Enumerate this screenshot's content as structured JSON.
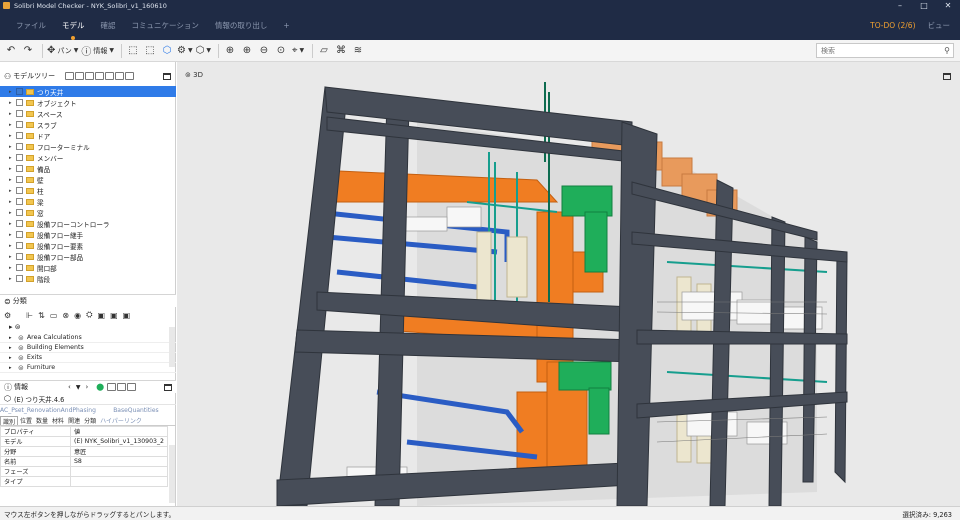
{
  "window": {
    "title": "Solibri Model Checker - NYK_Solibri_v1_160610"
  },
  "menu": {
    "items": [
      "ファイル",
      "モデル",
      "確認",
      "コミュニケーション",
      "情報の取り出し",
      "+"
    ],
    "active_index": 1,
    "todo": "TO-DO  (2/6)",
    "view": "ビュー"
  },
  "toolbar": {
    "pan_label": "パン",
    "info_label": "情報",
    "search_placeholder": "検索"
  },
  "model_tree": {
    "title": "モデルツリー",
    "items": [
      "つり天井",
      "オブジェクト",
      "スペース",
      "スラブ",
      "ドア",
      "フローターミナル",
      "メンバー",
      "備品",
      "壁",
      "柱",
      "梁",
      "窓",
      "設備フローコントローラ",
      "設備フロー継手",
      "設備フロー要素",
      "設備フロー部品",
      "開口部",
      "階段"
    ],
    "selected_index": 0
  },
  "classification": {
    "title": "分類",
    "items": [
      "Area Calculations",
      "Building Elements",
      "Exits",
      "Furniture"
    ]
  },
  "info": {
    "title": "情報",
    "object_name": "(E) つり天井.4.6",
    "tabset_top": [
      "AC_Pset_RenovationAndPhasing",
      "BaseQuantities"
    ],
    "tabs": [
      "識別",
      "位置",
      "数量",
      "材料",
      "関連",
      "分類",
      "ハイパーリンク"
    ],
    "table": [
      [
        "プロパティ",
        "値"
      ],
      [
        "モデル",
        "(E) NYK_Solibri_v1_130903_2"
      ],
      [
        "分野",
        "意匠"
      ],
      [
        "名前",
        "S8"
      ],
      [
        "フェーズ",
        ""
      ],
      [
        "タイプ",
        ""
      ]
    ]
  },
  "viewport": {
    "label": "3D"
  },
  "status": {
    "hint": "マウス左ボタンを押しながらドラッグするとパンします。",
    "selection": "選択済み: 9,263"
  },
  "colors": {
    "titlebar_bg": "#1f2b45",
    "accent": "#f0a030",
    "selection": "#2f7be8",
    "steel": "#474d58",
    "duct_orange": "#f07d22",
    "pipe_blue": "#2a5cc4",
    "pipe_green": "#1fae5a"
  }
}
